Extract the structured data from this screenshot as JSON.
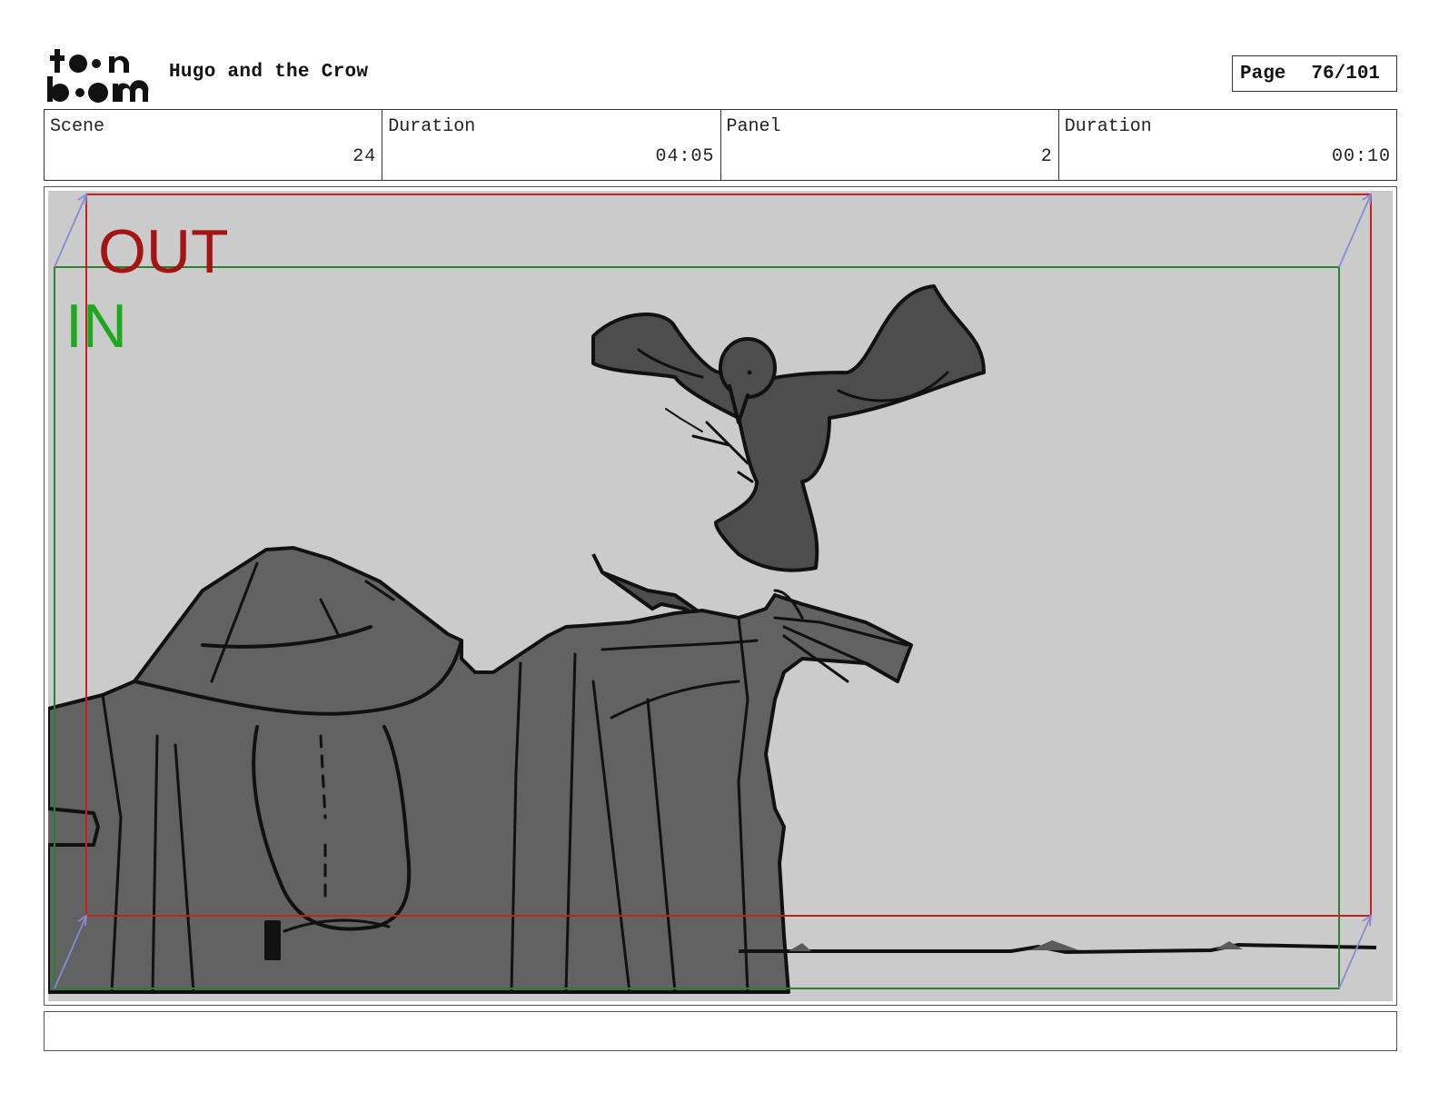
{
  "header": {
    "logo_text": "toon boom",
    "project_title": "Hugo and the Crow",
    "page_label": "Page",
    "page_number": "76/101"
  },
  "info": {
    "scene_label": "Scene",
    "scene_value": "24",
    "scene_duration_label": "Duration",
    "scene_duration_value": "04:05",
    "panel_label": "Panel",
    "panel_value": "2",
    "panel_duration_label": "Duration",
    "panel_duration_value": "00:10"
  },
  "panel": {
    "out_label": "OUT",
    "in_label": "IN",
    "out_color": "#a31515",
    "in_color": "#1fa81f",
    "out_frame_color": "#c42020",
    "in_frame_color": "#2e7d32",
    "background_color": "#cbcbcb",
    "figure_color": "#5a5a5a"
  },
  "caption": {
    "text": ""
  }
}
